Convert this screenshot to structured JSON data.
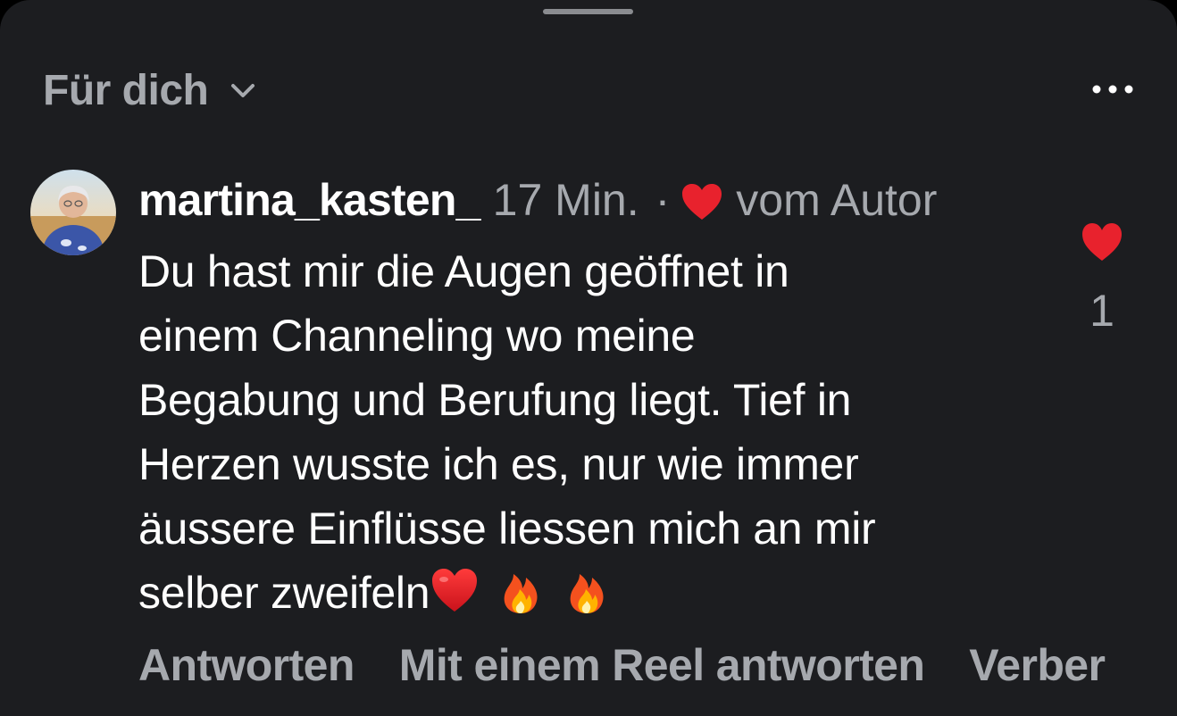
{
  "header": {
    "filter_label": "Für dich",
    "filter_icon": "chevron-down-icon",
    "more_icon": "more-horizontal-icon"
  },
  "comment": {
    "username": "martina_kasten_",
    "timestamp": "17 Min.",
    "separator": "·",
    "author_like_label": "vom Autor",
    "body_lines": [
      "Du hast mir die Augen geöffnet in",
      "einem Channeling wo meine",
      "Begabung und Berufung liegt. Tief in",
      "Herzen wusste ich es, nur wie immer",
      "äussere Einflüsse liessen mich an mir",
      "selber zweifeln"
    ],
    "emojis": [
      "❤️",
      "🔥",
      "🔥"
    ],
    "like_count": "1"
  },
  "actions": {
    "reply": "Antworten",
    "reply_reel": "Mit einem Reel antworten",
    "hide": "Verber"
  },
  "colors": {
    "background": "#1c1d20",
    "text_primary": "#ffffff",
    "text_secondary": "#a6a9ae",
    "heart_red": "#e8222d"
  }
}
